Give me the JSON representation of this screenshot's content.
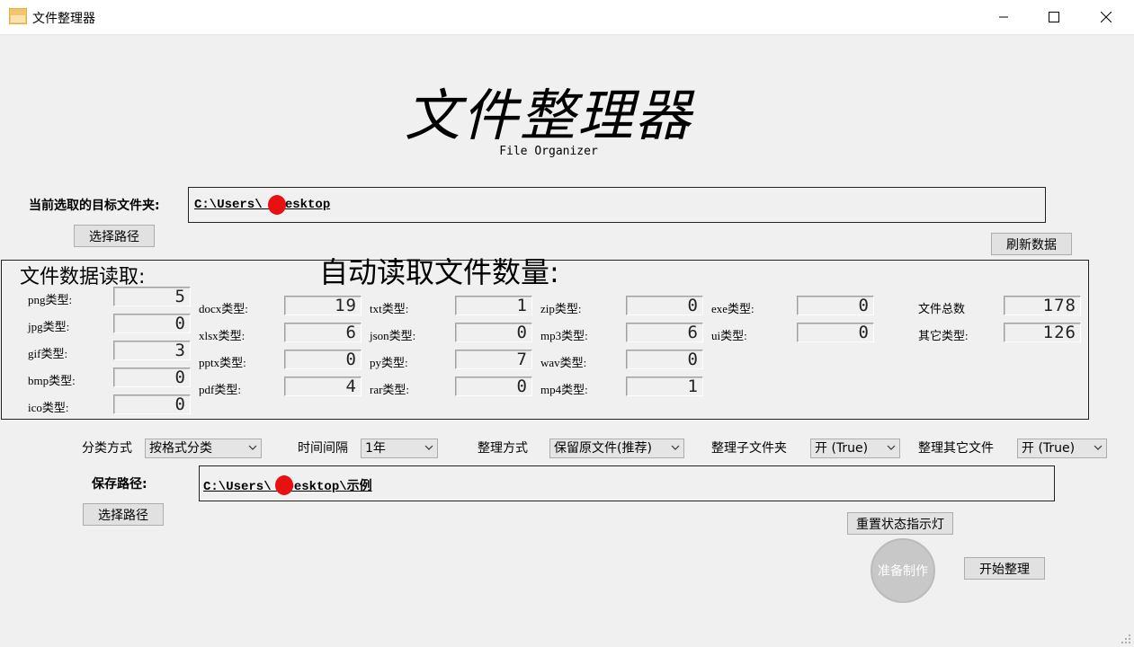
{
  "window": {
    "title": "文件整理器"
  },
  "header": {
    "title": "文件整理器",
    "subtitle": "File Organizer"
  },
  "target": {
    "label": "当前选取的目标文件夹:",
    "path": "C:\\Users\\   \\Desktop",
    "select_label": "选择路径",
    "refresh_label": "刷新数据"
  },
  "panel": {
    "title": "文件数据读取:",
    "auto_label": "自动读取文件数量:",
    "col1": [
      {
        "label": "png类型:",
        "value": "5"
      },
      {
        "label": "jpg类型:",
        "value": "0"
      },
      {
        "label": "gif类型:",
        "value": "3"
      },
      {
        "label": "bmp类型:",
        "value": "0"
      },
      {
        "label": "ico类型:",
        "value": "0"
      }
    ],
    "col2": [
      {
        "label": "docx类型:",
        "value": "19"
      },
      {
        "label": "xlsx类型:",
        "value": "6"
      },
      {
        "label": "pptx类型:",
        "value": "0"
      },
      {
        "label": "pdf类型:",
        "value": "4"
      }
    ],
    "col3": [
      {
        "label": "txt类型:",
        "value": "1"
      },
      {
        "label": "json类型:",
        "value": "0"
      },
      {
        "label": "py类型:",
        "value": "7"
      },
      {
        "label": "rar类型:",
        "value": "0"
      }
    ],
    "col4": [
      {
        "label": "zip类型:",
        "value": "0"
      },
      {
        "label": "mp3类型:",
        "value": "6"
      },
      {
        "label": "wav类型:",
        "value": "0"
      },
      {
        "label": "mp4类型:",
        "value": "1"
      }
    ],
    "col5": [
      {
        "label": "exe类型:",
        "value": "0"
      },
      {
        "label": "ui类型:",
        "value": "0"
      }
    ],
    "col6": [
      {
        "label": "文件总数",
        "value": "178"
      },
      {
        "label": "其它类型:",
        "value": "126"
      }
    ]
  },
  "options": {
    "classify": {
      "label": "分类方式",
      "value": "按格式分类"
    },
    "interval": {
      "label": "时间间隔",
      "value": "1年"
    },
    "method": {
      "label": "整理方式",
      "value": "保留原文件(推荐)"
    },
    "subfolder": {
      "label": "整理子文件夹",
      "value": "开 (True)"
    },
    "other": {
      "label": "整理其它文件",
      "value": "开 (True)"
    }
  },
  "save": {
    "label": "保存路径:",
    "path": "C:\\Users\\   \\Desktop\\示例",
    "select_label": "选择路径"
  },
  "actions": {
    "reset_label": "重置状态指示灯",
    "indicator_label": "准备制作",
    "start_label": "开始整理"
  },
  "colors": {
    "redaction": "#e81010",
    "indicator": "#c8c8c8"
  }
}
